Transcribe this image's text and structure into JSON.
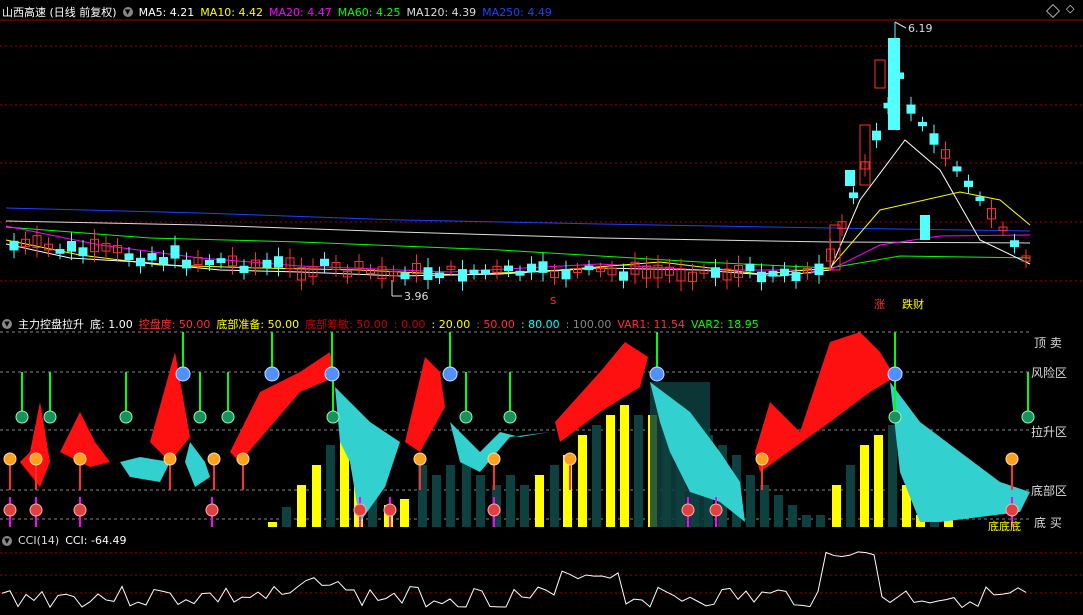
{
  "main": {
    "title": "山西高速 (日线 前复权)",
    "ma": [
      {
        "label": "MA5: 4.21",
        "color": "#ffffff"
      },
      {
        "label": "MA10: 4.42",
        "color": "#ffff00"
      },
      {
        "label": "MA20: 4.47",
        "color": "#ff00ff"
      },
      {
        "label": "MA60: 4.25",
        "color": "#00ff00"
      },
      {
        "label": "MA120: 4.39",
        "color": "#dddddd"
      },
      {
        "label": "MA250: 4.49",
        "color": "#2040ff"
      }
    ],
    "high_label": "6.19",
    "low_label": "3.96",
    "marker_s": "S",
    "tag_zhang": "涨",
    "tag_diecai": "跌财"
  },
  "indicator": {
    "title": "主力控盘拉升",
    "params": [
      {
        "label": "底: 1.00",
        "color": "#ffffff"
      },
      {
        "label": "控盘度: 50.00",
        "color": "#ff3030"
      },
      {
        "label": "底部准备: 50.00",
        "color": "#ffff00"
      },
      {
        "label": "底部筹敏: 50.00",
        "color": "#c00000"
      },
      {
        "label": ": 0.00",
        "color": "#c00000"
      },
      {
        "label": ": 20.00",
        "color": "#ffff00"
      },
      {
        "label": ": 50.00",
        "color": "#ff3030"
      },
      {
        "label": ": 80.00",
        "color": "#00ffff"
      },
      {
        "label": ": 100.00",
        "color": "#888888"
      },
      {
        "label": "VAR1: 11.54",
        "color": "#ff3030"
      },
      {
        "label": "VAR2: 18.95",
        "color": "#00ff00"
      }
    ],
    "zones": [
      "顶 卖",
      "风险区",
      "拉升区",
      "底部区",
      "底 买"
    ],
    "bottom_text": "底底底"
  },
  "cci": {
    "title": "CCI(14)",
    "value": "CCI: -64.49"
  },
  "colors": {
    "up": "#ff3030",
    "down": "#54ffff",
    "grid": "#c00000"
  }
}
